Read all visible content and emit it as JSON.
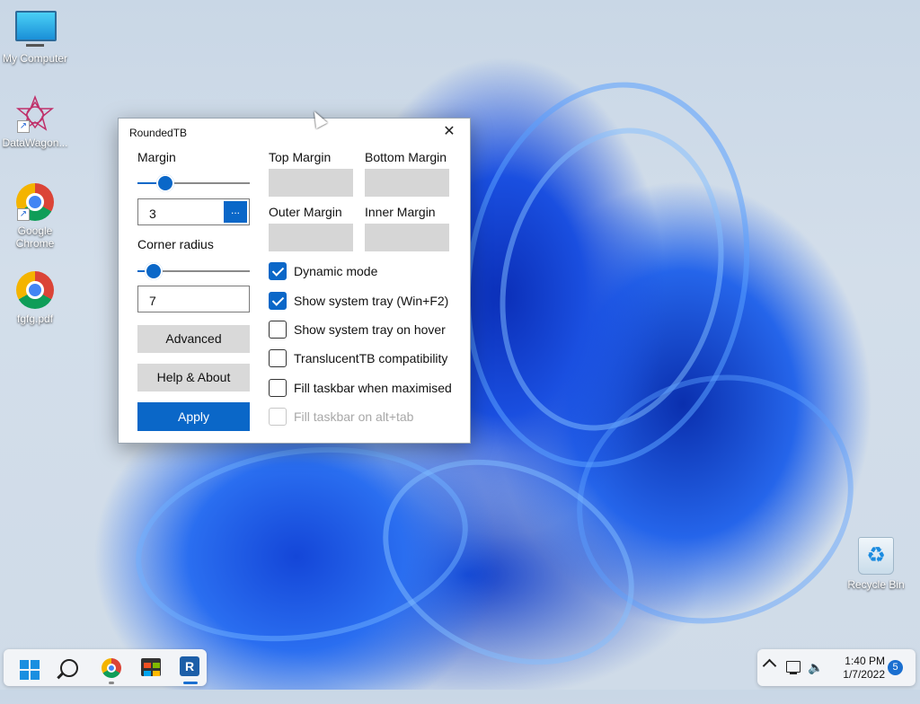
{
  "desktop": {
    "icons": [
      {
        "label": "My Computer"
      },
      {
        "label": "DataWagon..."
      },
      {
        "label": "Google Chrome"
      },
      {
        "label": "fgfg.pdf"
      },
      {
        "label": "Recycle Bin"
      }
    ]
  },
  "window": {
    "title": "RoundedTB",
    "close_glyph": "✕",
    "margin_label": "Margin",
    "margin_value": "3",
    "margin_slider_fraction": 0.2,
    "dots_label": "...",
    "corner_radius_label": "Corner radius",
    "corner_radius_value": "7",
    "corner_slider_fraction": 0.08,
    "advanced_label": "Advanced",
    "help_label": "Help & About",
    "apply_label": "Apply",
    "top_margin_label": "Top Margin",
    "bottom_margin_label": "Bottom Margin",
    "outer_margin_label": "Outer Margin",
    "inner_margin_label": "Inner Margin",
    "checkboxes": [
      {
        "label": "Dynamic mode",
        "checked": true,
        "enabled": true
      },
      {
        "label": "Show system tray (Win+F2)",
        "checked": true,
        "enabled": true
      },
      {
        "label": "Show system tray on hover",
        "checked": false,
        "enabled": true
      },
      {
        "label": "TranslucentTB compatibility",
        "checked": false,
        "enabled": true
      },
      {
        "label": "Fill taskbar when maximised",
        "checked": false,
        "enabled": true
      },
      {
        "label": "Fill taskbar on alt+tab",
        "checked": false,
        "enabled": false
      }
    ]
  },
  "taskbar": {
    "rtb_letter": "R",
    "time": "1:40 PM",
    "date": "1/7/2022",
    "notifications": "5",
    "volume_glyph": "🔈"
  },
  "colors": {
    "accent": "#0a67c8",
    "button_gray": "#d9d9d9"
  }
}
